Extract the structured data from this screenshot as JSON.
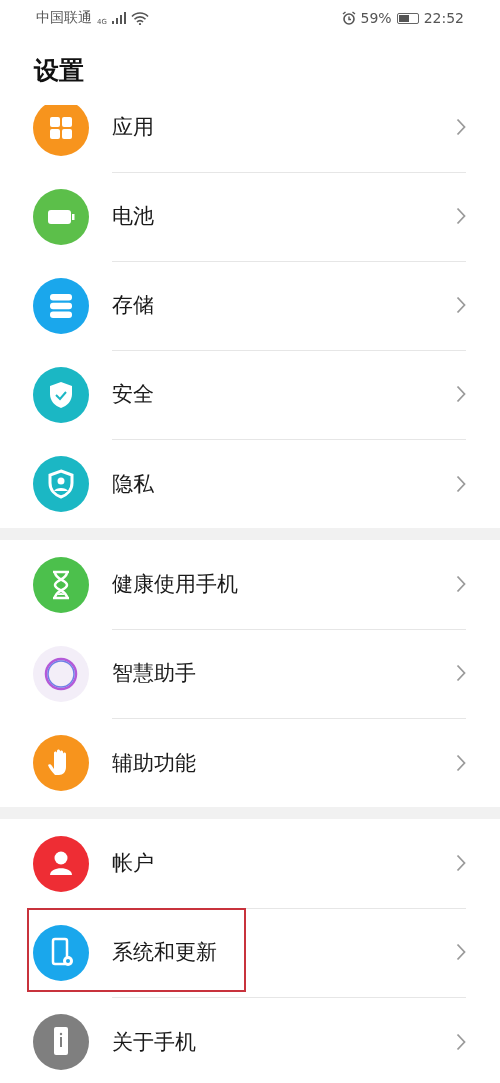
{
  "status_bar": {
    "carrier": "中国联通",
    "network": "4G",
    "battery_percent": "59%",
    "time": "22:52"
  },
  "title": "设置",
  "groups": [
    {
      "items": [
        {
          "label": "应用",
          "kind": "apps",
          "color": "#f7941d",
          "highlighted": false
        },
        {
          "label": "电池",
          "kind": "battery",
          "color": "#5cbf4a",
          "highlighted": false
        },
        {
          "label": "存储",
          "kind": "storage",
          "color": "#1aa7ec",
          "highlighted": false
        },
        {
          "label": "安全",
          "kind": "security",
          "color": "#1bb7c4",
          "highlighted": false
        },
        {
          "label": "隐私",
          "kind": "privacy",
          "color": "#1bb7c4",
          "highlighted": false
        }
      ]
    },
    {
      "items": [
        {
          "label": "健康使用手机",
          "kind": "hourglass",
          "color": "#4cc04c",
          "highlighted": false
        },
        {
          "label": "智慧助手",
          "kind": "assistant",
          "color": "#f3eef8",
          "highlighted": false
        },
        {
          "label": "辅助功能",
          "kind": "hand",
          "color": "#f7941d",
          "highlighted": false
        }
      ]
    },
    {
      "items": [
        {
          "label": "帐户",
          "kind": "account",
          "color": "#ee2d34",
          "highlighted": false
        },
        {
          "label": "系统和更新",
          "kind": "system",
          "color": "#1aa7ec",
          "highlighted": true
        },
        {
          "label": "关于手机",
          "kind": "about",
          "color": "#7f7f7f",
          "highlighted": false
        }
      ]
    }
  ]
}
